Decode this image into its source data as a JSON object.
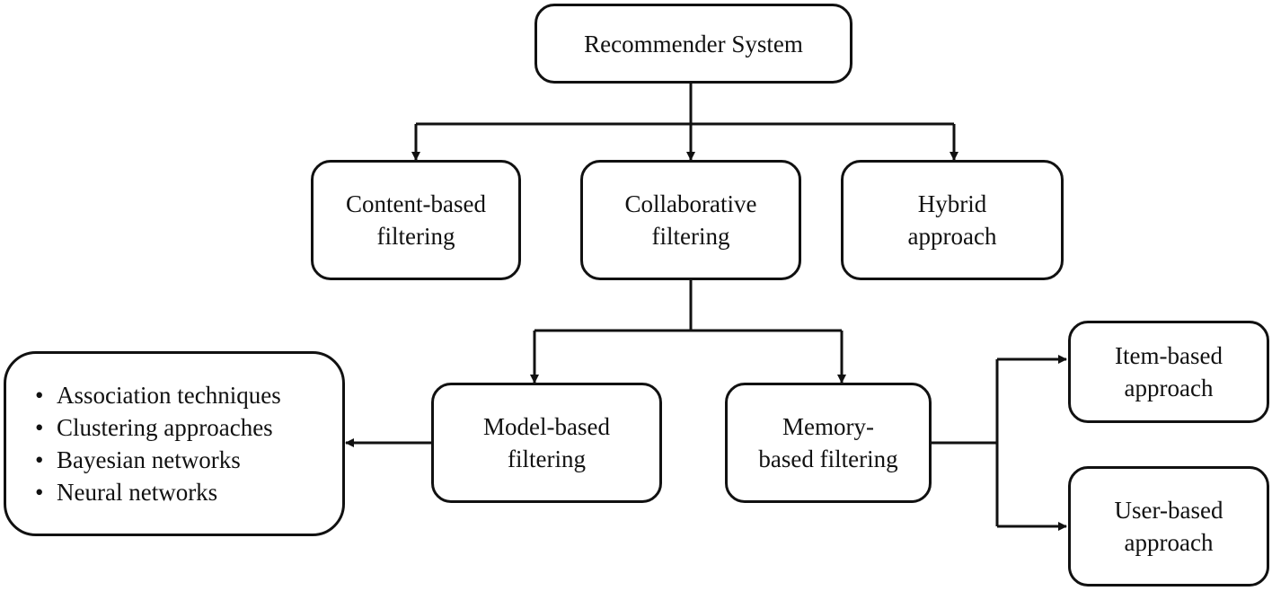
{
  "diagram": {
    "type": "hierarchy",
    "nodes": {
      "root": "Recommender System",
      "content_based": "Content-based\nfiltering",
      "collaborative": "Collaborative\nfiltering",
      "hybrid": "Hybrid\napproach",
      "model_based": "Model-based\nfiltering",
      "memory_based": "Memory-\nbased filtering",
      "item_based": "Item-based\napproach",
      "user_based": "User-based\napproach"
    },
    "model_techniques": [
      "Association techniques",
      "Clustering approaches",
      "Bayesian networks",
      "Neural networks"
    ],
    "edges": [
      {
        "from": "root",
        "to": "content_based"
      },
      {
        "from": "root",
        "to": "collaborative"
      },
      {
        "from": "root",
        "to": "hybrid"
      },
      {
        "from": "collaborative",
        "to": "model_based"
      },
      {
        "from": "collaborative",
        "to": "memory_based"
      },
      {
        "from": "model_based",
        "to": "model_techniques"
      },
      {
        "from": "memory_based",
        "to": "item_based"
      },
      {
        "from": "memory_based",
        "to": "user_based"
      }
    ]
  }
}
